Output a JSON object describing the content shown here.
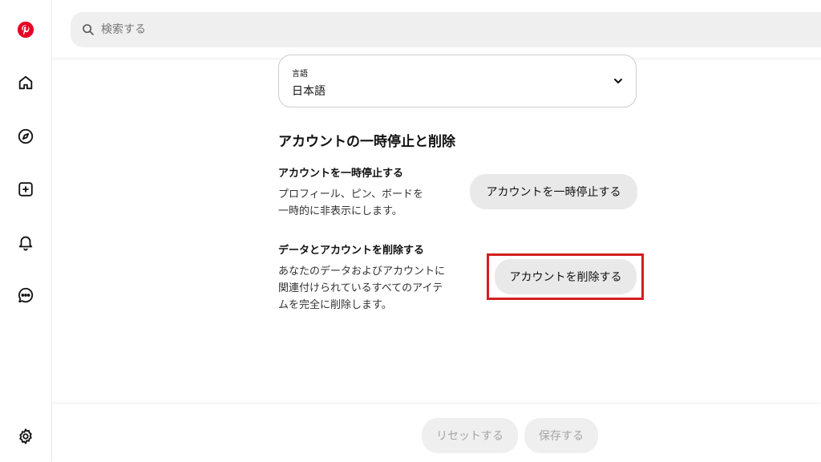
{
  "sidebar": {
    "items": [
      {
        "name": "pinterest-logo",
        "icon": "pinterest-logo",
        "color": "#e60023"
      },
      {
        "name": "home",
        "icon": "home-icon"
      },
      {
        "name": "explore",
        "icon": "compass-icon"
      },
      {
        "name": "create",
        "icon": "plus-square-icon"
      },
      {
        "name": "notifications",
        "icon": "bell-icon"
      },
      {
        "name": "messages",
        "icon": "chat-bubble-icon"
      },
      {
        "name": "settings",
        "icon": "gear-icon"
      }
    ]
  },
  "search": {
    "placeholder": "検索する",
    "value": ""
  },
  "language": {
    "label": "言語",
    "value": "日本語"
  },
  "section": {
    "title": "アカウントの一時停止と削除"
  },
  "deactivate": {
    "title": "アカウントを一時停止する",
    "desc_lines": [
      "プロフィール、ピン、ボードを",
      "一時的に非表示にします。"
    ],
    "button": "アカウントを一時停止する"
  },
  "delete": {
    "title": "データとアカウントを削除する",
    "desc_lines": [
      "あなたのデータおよびアカウントに",
      "関連付けられているすべてのアイテ",
      "ムを完全に削除します。"
    ],
    "button": "アカウントを削除する",
    "highlight_color": "#d21f1f"
  },
  "footer": {
    "reset_label": "リセットする",
    "save_label": "保存する"
  }
}
